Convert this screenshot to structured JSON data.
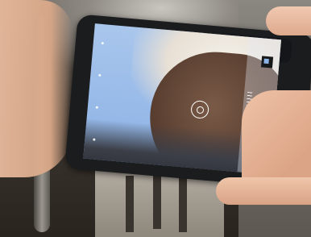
{
  "photo": {
    "description_icons": [
      "camera-mode-icon",
      "focus-ring-icon",
      "camera-icon",
      "grid-icon"
    ],
    "overlay_text": ""
  },
  "colors": {
    "sky": "#8cb2e6",
    "phone": "#1b1c1e",
    "skin": "#e7b99c"
  }
}
